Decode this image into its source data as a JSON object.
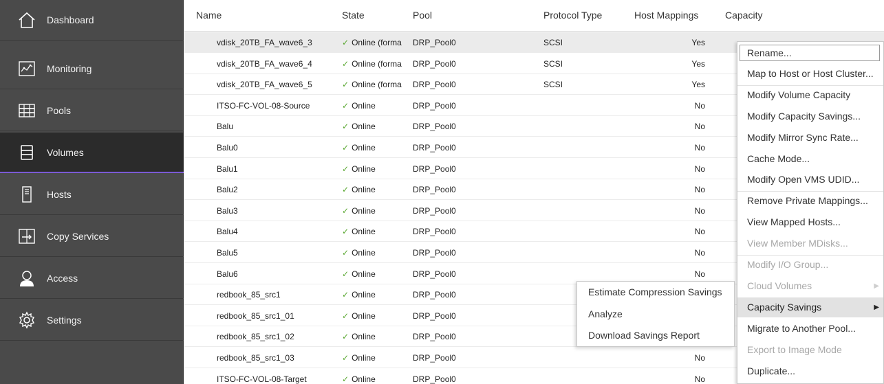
{
  "sidebar": {
    "items": [
      {
        "label": "Dashboard",
        "icon": "home-icon"
      },
      {
        "label": "Monitoring",
        "icon": "monitoring-icon"
      },
      {
        "label": "Pools",
        "icon": "pools-icon"
      },
      {
        "label": "Volumes",
        "icon": "volumes-icon",
        "active": true
      },
      {
        "label": "Hosts",
        "icon": "hosts-icon"
      },
      {
        "label": "Copy Services",
        "icon": "copy-services-icon"
      },
      {
        "label": "Access",
        "icon": "access-icon"
      },
      {
        "label": "Settings",
        "icon": "settings-icon"
      }
    ]
  },
  "table": {
    "headers": {
      "name": "Name",
      "state": "State",
      "pool": "Pool",
      "protocol": "Protocol Type",
      "mappings": "Host Mappings",
      "capacity": "Capacity"
    },
    "rows": [
      {
        "name": "vdisk_20TB_FA_wave6_3",
        "state": "Online (forma",
        "pool": "DRP_Pool0",
        "protocol": "SCSI",
        "mapping": "Yes"
      },
      {
        "name": "vdisk_20TB_FA_wave6_4",
        "state": "Online (forma",
        "pool": "DRP_Pool0",
        "protocol": "SCSI",
        "mapping": "Yes"
      },
      {
        "name": "vdisk_20TB_FA_wave6_5",
        "state": "Online (forma",
        "pool": "DRP_Pool0",
        "protocol": "SCSI",
        "mapping": "Yes"
      },
      {
        "name": "ITSO-FC-VOL-08-Source",
        "state": "Online",
        "pool": "DRP_Pool0",
        "protocol": "",
        "mapping": "No"
      },
      {
        "name": "Balu",
        "state": "Online",
        "pool": "DRP_Pool0",
        "protocol": "",
        "mapping": "No"
      },
      {
        "name": "Balu0",
        "state": "Online",
        "pool": "DRP_Pool0",
        "protocol": "",
        "mapping": "No"
      },
      {
        "name": "Balu1",
        "state": "Online",
        "pool": "DRP_Pool0",
        "protocol": "",
        "mapping": "No"
      },
      {
        "name": "Balu2",
        "state": "Online",
        "pool": "DRP_Pool0",
        "protocol": "",
        "mapping": "No"
      },
      {
        "name": "Balu3",
        "state": "Online",
        "pool": "DRP_Pool0",
        "protocol": "",
        "mapping": "No"
      },
      {
        "name": "Balu4",
        "state": "Online",
        "pool": "DRP_Pool0",
        "protocol": "",
        "mapping": "No"
      },
      {
        "name": "Balu5",
        "state": "Online",
        "pool": "DRP_Pool0",
        "protocol": "",
        "mapping": "No"
      },
      {
        "name": "Balu6",
        "state": "Online",
        "pool": "DRP_Pool0",
        "protocol": "",
        "mapping": "No"
      },
      {
        "name": "redbook_85_src1",
        "state": "Online",
        "pool": "DRP_Pool0",
        "protocol": "",
        "mapping": ""
      },
      {
        "name": "redbook_85_src1_01",
        "state": "Online",
        "pool": "DRP_Pool0",
        "protocol": "",
        "mapping": ""
      },
      {
        "name": "redbook_85_src1_02",
        "state": "Online",
        "pool": "DRP_Pool0",
        "protocol": "",
        "mapping": ""
      },
      {
        "name": "redbook_85_src1_03",
        "state": "Online",
        "pool": "DRP_Pool0",
        "protocol": "",
        "mapping": "No"
      },
      {
        "name": "ITSO-FC-VOL-08-Target",
        "state": "Online",
        "pool": "DRP_Pool0",
        "protocol": "",
        "mapping": "No"
      }
    ]
  },
  "context_menu": {
    "items": [
      {
        "label": "Rename...",
        "disabled": false
      },
      {
        "label": "Map to Host or Host Cluster...",
        "disabled": false
      },
      {
        "label": "Modify Volume Capacity",
        "disabled": false
      },
      {
        "label": "Modify Capacity Savings...",
        "disabled": false
      },
      {
        "label": "Modify Mirror Sync Rate...",
        "disabled": false
      },
      {
        "label": "Cache Mode...",
        "disabled": false
      },
      {
        "label": "Modify Open VMS UDID...",
        "disabled": false
      },
      {
        "label": "Remove Private Mappings...",
        "disabled": false
      },
      {
        "label": "View Mapped Hosts...",
        "disabled": false
      },
      {
        "label": "View Member MDisks...",
        "disabled": true
      },
      {
        "label": "Modify I/O Group...",
        "disabled": true
      },
      {
        "label": "Cloud Volumes",
        "disabled": true,
        "submenu": true
      },
      {
        "label": "Capacity Savings",
        "disabled": false,
        "submenu": true,
        "highlighted": true
      },
      {
        "label": "Migrate to Another Pool...",
        "disabled": false
      },
      {
        "label": "Export to Image Mode",
        "disabled": true
      },
      {
        "label": "Duplicate...",
        "disabled": false
      }
    ]
  },
  "submenu": {
    "items": [
      {
        "label": "Estimate Compression Savings"
      },
      {
        "label": "Analyze"
      },
      {
        "label": "Download Savings Report"
      }
    ]
  },
  "colors": {
    "sidebar_bg": "#4a4a4a",
    "sidebar_active_bg": "#2b2b2b",
    "active_underline": "#7b5bd6",
    "check_green": "#5aa832",
    "selected_row_bg": "#ebebeb"
  }
}
